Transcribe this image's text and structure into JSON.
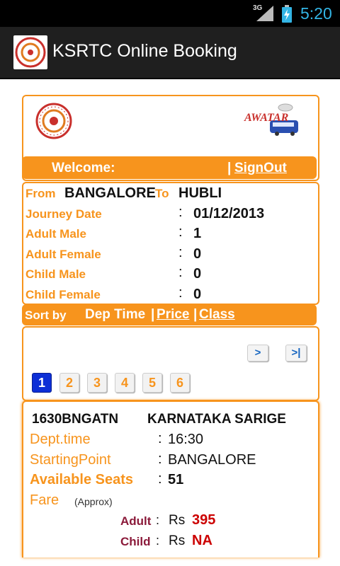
{
  "status_bar": {
    "network": "3G",
    "time": "5:20",
    "icons": [
      "signal-icon",
      "battery-icon"
    ]
  },
  "action_bar": {
    "title": "KSRTC Online Booking",
    "icon": "ksrtc-logo-icon"
  },
  "header": {
    "logo_left": "ksrtc-emblem-logo",
    "logo_right_text": "AWATAR",
    "welcome": "Welcome:",
    "separator": "|",
    "signout": "SignOut"
  },
  "journey": {
    "from_label": "From",
    "from_value": "BANGALORE",
    "to_label": "To",
    "to_value": "HUBLI",
    "rows": [
      {
        "label": "Journey Date",
        "value": "01/12/2013"
      },
      {
        "label": "Adult Male",
        "value": "1"
      },
      {
        "label": "Adult Female",
        "value": "0"
      },
      {
        "label": "Child Male",
        "value": "0"
      },
      {
        "label": "Child Female",
        "value": "0"
      }
    ]
  },
  "sort": {
    "label": "Sort by",
    "dep_time": "Dep Time",
    "sep": "|",
    "price": "Price",
    "class": "Class"
  },
  "pagination": {
    "next": ">",
    "last": ">|",
    "pages": [
      "1",
      "2",
      "3",
      "4",
      "5",
      "6"
    ],
    "current": "1"
  },
  "service": {
    "code": "1630BNGATN",
    "name": "KARNATAKA SARIGE",
    "dept_time_label": "Dept.time",
    "dept_time_value": "16:30",
    "starting_point_label": "StartingPoint",
    "starting_point_value": "BANGALORE",
    "seats_label": "Available Seats",
    "seats_value": "51",
    "fare_label": "Fare",
    "fare_note": "(Approx)",
    "adult_label": "Adult",
    "currency": "Rs",
    "adult_fare": "395",
    "child_label": "Child",
    "child_fare": "NA"
  },
  "colors": {
    "accent": "#f7941d",
    "fare_label": "#8b1a3a",
    "fare_value": "#cc0000",
    "page_active": "#0d2fd6"
  }
}
